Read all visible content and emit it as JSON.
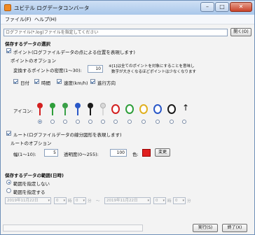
{
  "window": {
    "title": "ユビテル ログデータコンバータ"
  },
  "menu": {
    "file": "ファイル(F)",
    "help": "ヘルプ(H)"
  },
  "file_select": {
    "placeholder": "ログファイル(*.log)ファイルを指定してください",
    "open_button": "開く(O)"
  },
  "save_section": {
    "title": "保存するデータの選択"
  },
  "points": {
    "checkbox_label": "ポイント(ログファイルデータの点による位置を表現します)",
    "options_title": "ポイントのオプション",
    "density_label": "変換するポイントの密度(1〜30):",
    "density_value": "10",
    "note_line1": "※[1]は全てのポイントを対象にすることを意味し",
    "note_line2": "数字が大きくなるほどポイントは少なくなります",
    "fields": [
      {
        "label": "日付",
        "checked": true
      },
      {
        "label": "時間",
        "checked": true
      },
      {
        "label": "速度(km/h)",
        "checked": true
      },
      {
        "label": "進行方向",
        "checked": true
      }
    ],
    "icon_label": "アイコン:",
    "icon_colors": [
      "#d32020",
      "#2e9e3a",
      "#3aa048",
      "#2a58c8",
      "#1a1a1a",
      "#d8d8d8"
    ],
    "ring_colors": [
      "#d32020",
      "#2e9e3a",
      "#e0b020",
      "#2a58c8",
      "#1a1a1a"
    ],
    "selected_icon_index": 0
  },
  "route": {
    "checkbox_label": "ルート(ログファイルデータの線分図形を表現します)",
    "options_title": "ルートのオプション",
    "width_label": "幅(1〜10):",
    "width_value": "5",
    "opacity_label": "透明度(0〜255):",
    "opacity_value": "100",
    "color_label": "色:",
    "color_value": "#e02020",
    "change_button": "変更"
  },
  "range": {
    "title": "保存するデータの範囲(日時)",
    "no_range_label": "範囲を指定しない",
    "set_range_label": "範囲を指定する",
    "start_date": "2019年11月22日",
    "start_hour": "0",
    "start_minute": "0",
    "hour_label": "時",
    "minute_label": "分",
    "separator": "〜",
    "end_date": "2019年11月22日",
    "end_hour": "0",
    "end_minute": "0"
  },
  "footer": {
    "run_button": "実行(S)",
    "exit_button": "終了(X)"
  }
}
